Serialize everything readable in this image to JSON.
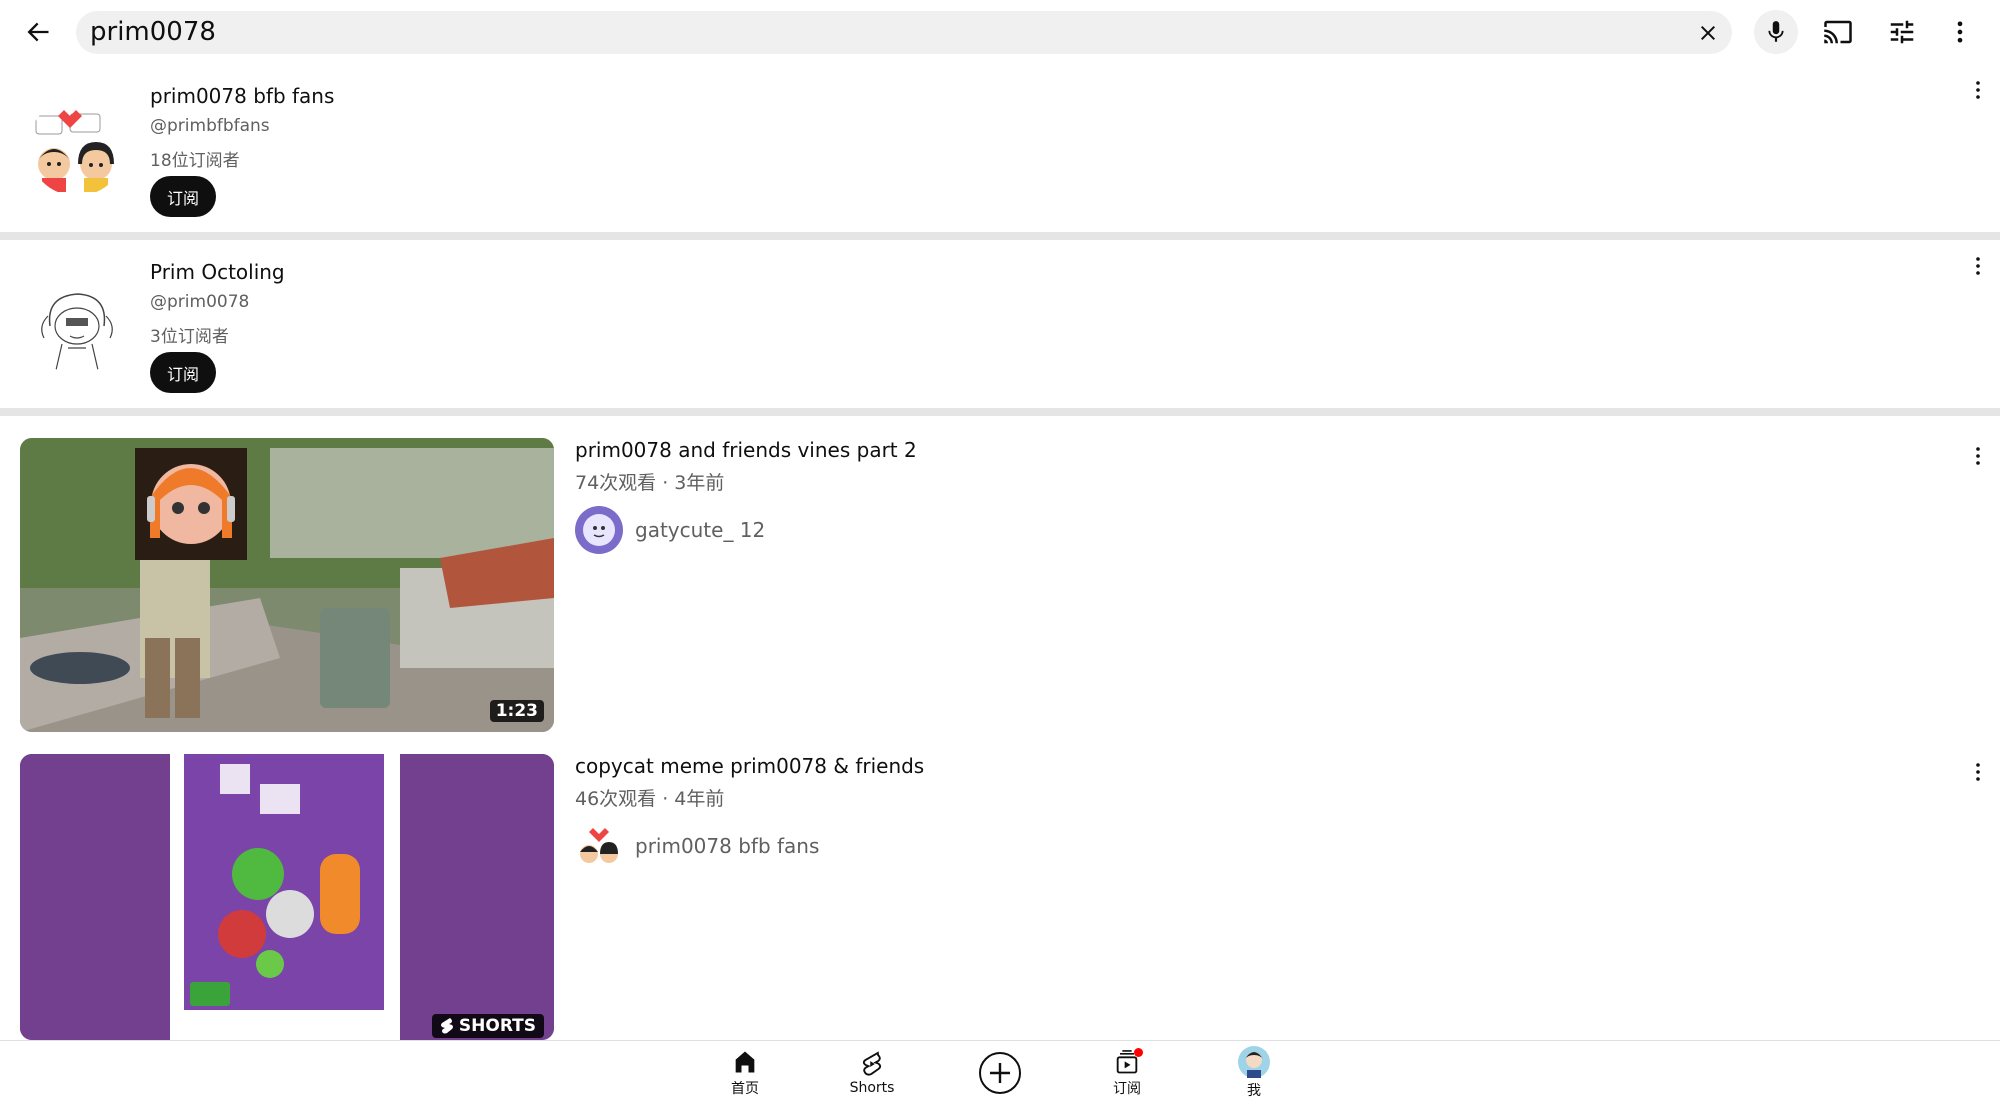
{
  "search": {
    "query": "prim0078"
  },
  "channels": [
    {
      "name": "prim0078 bfb fans",
      "handle": "@primbfbfans",
      "subscribers": "18位订阅者",
      "subscribe_label": "订阅"
    },
    {
      "name": "Prim Octoling",
      "handle": "@prim0078",
      "subscribers": "3位订阅者",
      "subscribe_label": "订阅"
    }
  ],
  "videos": [
    {
      "title": "prim0078 and friends vines part 2",
      "meta": "74次观看 · 3年前",
      "channel": "gatycute_ 12",
      "duration": "1:23"
    },
    {
      "title": "copycat meme prim0078 & friends",
      "meta": "46次观看 · 4年前",
      "channel": "prim0078 bfb fans",
      "badge": "SHORTS"
    }
  ],
  "bottom_nav": {
    "home": "首页",
    "shorts": "Shorts",
    "subscriptions": "订阅",
    "me": "我"
  },
  "colors": {
    "subscribe_bg": "#0f0f0f",
    "divider": "#e5e5e5",
    "search_bg": "#f0f0f0",
    "notification": "#ff0000",
    "shorts_bg": "#6b3a86"
  }
}
